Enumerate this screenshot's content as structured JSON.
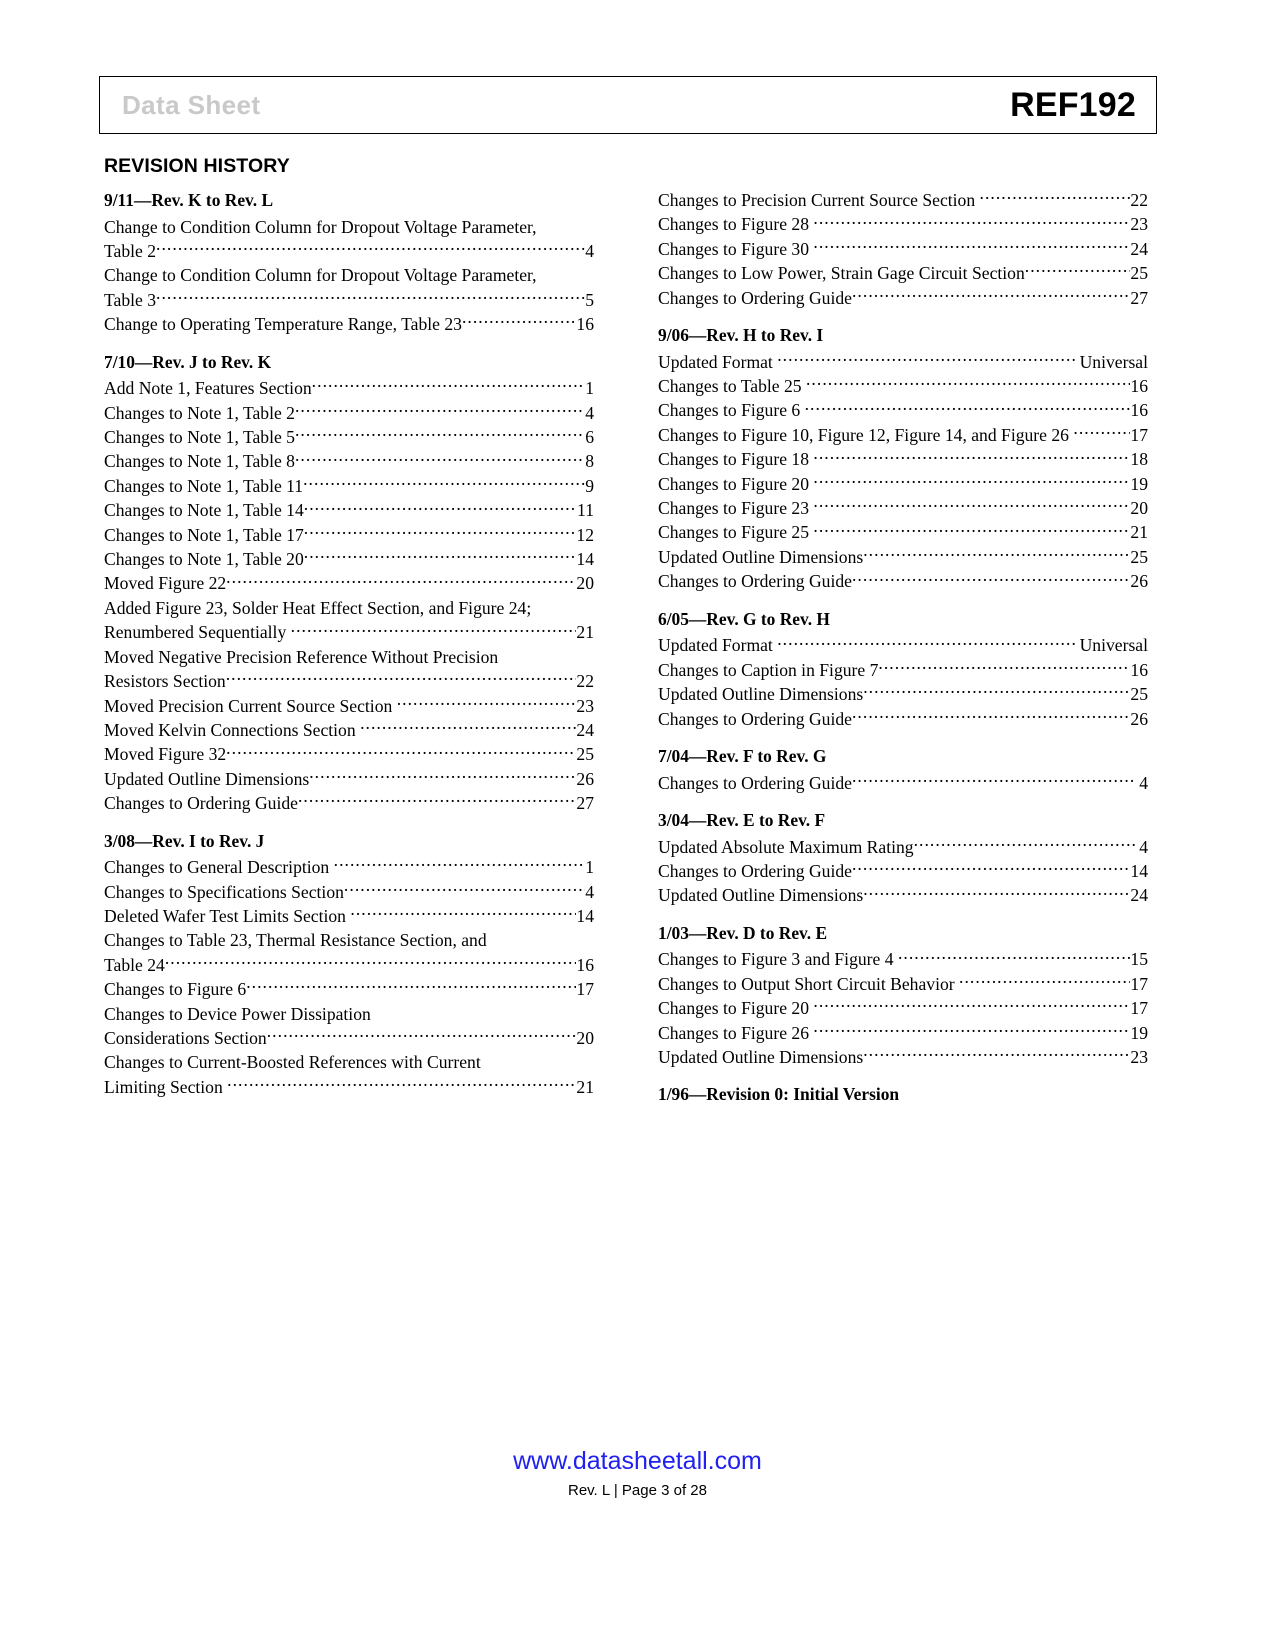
{
  "header": {
    "doc_type": "Data Sheet",
    "part_number": "REF192"
  },
  "section_title": "REVISION HISTORY",
  "footer": {
    "url": "www.datasheetall.com",
    "rev_line": "Rev. L | Page 3 of 28"
  },
  "left_column": [
    {
      "heading": "9/11—Rev. K to Rev. L",
      "entries": [
        {
          "lines": [
            "Change to Condition Column for Dropout Voltage Parameter,",
            "Table 2"
          ],
          "page": "4"
        },
        {
          "lines": [
            "Change to Condition Column for Dropout Voltage Parameter,",
            "Table 3"
          ],
          "page": "5"
        },
        {
          "lines": [
            "Change to Operating Temperature Range, Table 23"
          ],
          "page": "16"
        }
      ]
    },
    {
      "heading": "7/10—Rev. J to Rev. K",
      "entries": [
        {
          "lines": [
            "Add Note 1, Features Section"
          ],
          "page": "1"
        },
        {
          "lines": [
            "Changes to Note 1, Table 2"
          ],
          "page": "4"
        },
        {
          "lines": [
            "Changes to Note 1, Table 5"
          ],
          "page": "6"
        },
        {
          "lines": [
            "Changes to Note 1, Table 8"
          ],
          "page": "8"
        },
        {
          "lines": [
            "Changes to Note 1, Table 11"
          ],
          "page": "9"
        },
        {
          "lines": [
            "Changes to Note 1, Table 14"
          ],
          "page": "11"
        },
        {
          "lines": [
            "Changes to Note 1, Table 17"
          ],
          "page": "12"
        },
        {
          "lines": [
            "Changes to Note 1, Table 20"
          ],
          "page": "14"
        },
        {
          "lines": [
            "Moved Figure 22"
          ],
          "page": "20"
        },
        {
          "lines": [
            "Added Figure 23, Solder Heat Effect Section, and Figure 24;",
            "Renumbered Sequentially "
          ],
          "page": "21"
        },
        {
          "lines": [
            "Moved Negative Precision Reference Without Precision",
            "Resistors Section"
          ],
          "page": "22"
        },
        {
          "lines": [
            "Moved Precision Current Source Section "
          ],
          "page": "23"
        },
        {
          "lines": [
            "Moved Kelvin Connections Section "
          ],
          "page": "24"
        },
        {
          "lines": [
            "Moved Figure 32"
          ],
          "page": "25"
        },
        {
          "lines": [
            "Updated Outline Dimensions"
          ],
          "page": "26"
        },
        {
          "lines": [
            "Changes to Ordering Guide"
          ],
          "page": "27"
        }
      ]
    },
    {
      "heading": "3/08—Rev. I to Rev. J",
      "entries": [
        {
          "lines": [
            "Changes to General Description "
          ],
          "page": "1"
        },
        {
          "lines": [
            "Changes to Specifications Section"
          ],
          "page": "4"
        },
        {
          "lines": [
            "Deleted Wafer Test Limits Section "
          ],
          "page": "14"
        },
        {
          "lines": [
            "Changes to Table 23, Thermal Resistance Section, and",
            "Table 24"
          ],
          "page": "16"
        },
        {
          "lines": [
            "Changes to Figure 6"
          ],
          "page": "17"
        },
        {
          "lines": [
            "Changes to Device Power Dissipation",
            "Considerations Section"
          ],
          "page": "20"
        },
        {
          "lines": [
            "Changes to Current-Boosted References with Current",
            "Limiting Section "
          ],
          "page": "21"
        }
      ]
    }
  ],
  "right_column": [
    {
      "heading": null,
      "entries": [
        {
          "lines": [
            "Changes to Precision Current Source Section "
          ],
          "page": "22"
        },
        {
          "lines": [
            "Changes to Figure 28 "
          ],
          "page": "23"
        },
        {
          "lines": [
            "Changes to Figure 30 "
          ],
          "page": "24"
        },
        {
          "lines": [
            "Changes to Low Power, Strain Gage Circuit Section"
          ],
          "page": "25"
        },
        {
          "lines": [
            "Changes to Ordering Guide"
          ],
          "page": "27"
        }
      ]
    },
    {
      "heading": "9/06—Rev. H to Rev. I",
      "entries": [
        {
          "lines": [
            "Updated Format "
          ],
          "page": " Universal"
        },
        {
          "lines": [
            "Changes to Table 25 "
          ],
          "page": "16"
        },
        {
          "lines": [
            "Changes to Figure 6 "
          ],
          "page": "16"
        },
        {
          "lines": [
            "Changes to Figure 10, Figure 12, Figure 14, and Figure 26 "
          ],
          "page": "17"
        },
        {
          "lines": [
            "Changes to Figure 18 "
          ],
          "page": "18"
        },
        {
          "lines": [
            "Changes to Figure 20 "
          ],
          "page": "19"
        },
        {
          "lines": [
            "Changes to Figure 23 "
          ],
          "page": "20"
        },
        {
          "lines": [
            "Changes to Figure 25 "
          ],
          "page": "21"
        },
        {
          "lines": [
            "Updated Outline Dimensions"
          ],
          "page": "25"
        },
        {
          "lines": [
            "Changes to Ordering Guide"
          ],
          "page": "26"
        }
      ]
    },
    {
      "heading": "6/05—Rev. G to Rev. H",
      "entries": [
        {
          "lines": [
            "Updated Format "
          ],
          "page": " Universal"
        },
        {
          "lines": [
            "Changes to Caption in Figure 7"
          ],
          "page": "16"
        },
        {
          "lines": [
            "Updated Outline Dimensions"
          ],
          "page": "25"
        },
        {
          "lines": [
            "Changes to Ordering Guide"
          ],
          "page": "26"
        }
      ]
    },
    {
      "heading": "7/04—Rev. F to Rev. G",
      "entries": [
        {
          "lines": [
            "Changes to Ordering Guide"
          ],
          "page": " 4"
        }
      ]
    },
    {
      "heading": "3/04—Rev. E to Rev. F",
      "entries": [
        {
          "lines": [
            "Updated Absolute Maximum Rating"
          ],
          "page": " 4"
        },
        {
          "lines": [
            "Changes to Ordering Guide"
          ],
          "page": "14"
        },
        {
          "lines": [
            "Updated Outline Dimensions"
          ],
          "page": "24"
        }
      ]
    },
    {
      "heading": "1/03—Rev. D to Rev. E",
      "entries": [
        {
          "lines": [
            "Changes to Figure 3 and Figure 4 "
          ],
          "page": "15"
        },
        {
          "lines": [
            "Changes to Output Short Circuit Behavior "
          ],
          "page": "17"
        },
        {
          "lines": [
            "Changes to Figure 20 "
          ],
          "page": "17"
        },
        {
          "lines": [
            "Changes to Figure 26 "
          ],
          "page": "19"
        },
        {
          "lines": [
            "Updated Outline Dimensions"
          ],
          "page": "23"
        }
      ]
    },
    {
      "heading": "1/96—Revision 0: Initial Version",
      "entries": []
    }
  ]
}
